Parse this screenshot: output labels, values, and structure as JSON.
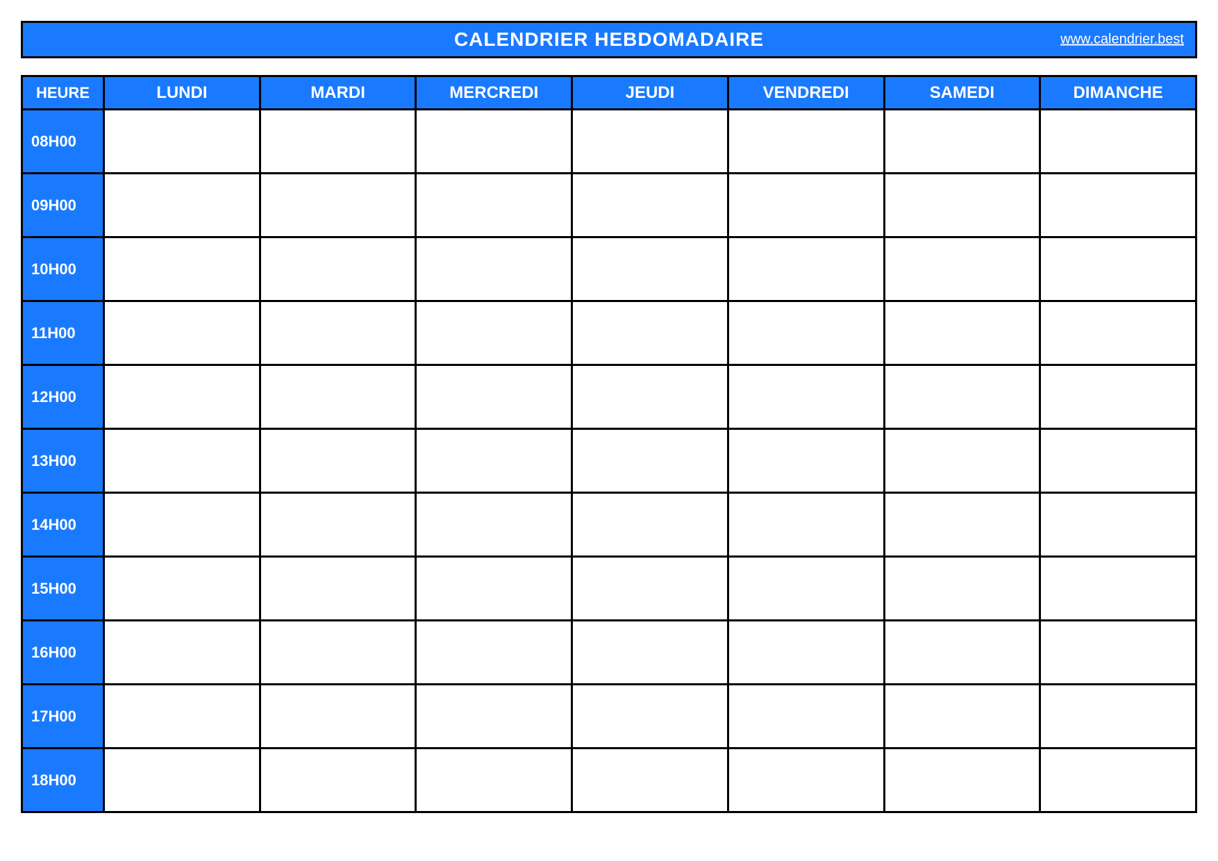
{
  "header": {
    "title": "CALENDRIER HEBDOMADAIRE",
    "site_link": "www.calendrier.best"
  },
  "columns": {
    "heure": "HEURE",
    "days": [
      "LUNDI",
      "MARDI",
      "MERCREDI",
      "JEUDI",
      "VENDREDI",
      "SAMEDI",
      "DIMANCHE"
    ]
  },
  "hours": [
    "08H00",
    "09H00",
    "10H00",
    "11H00",
    "12H00",
    "13H00",
    "14H00",
    "15H00",
    "16H00",
    "17H00",
    "18H00"
  ],
  "colors": {
    "accent": "#1a7aff",
    "border": "#000000",
    "text_on_accent": "#ffffff"
  }
}
